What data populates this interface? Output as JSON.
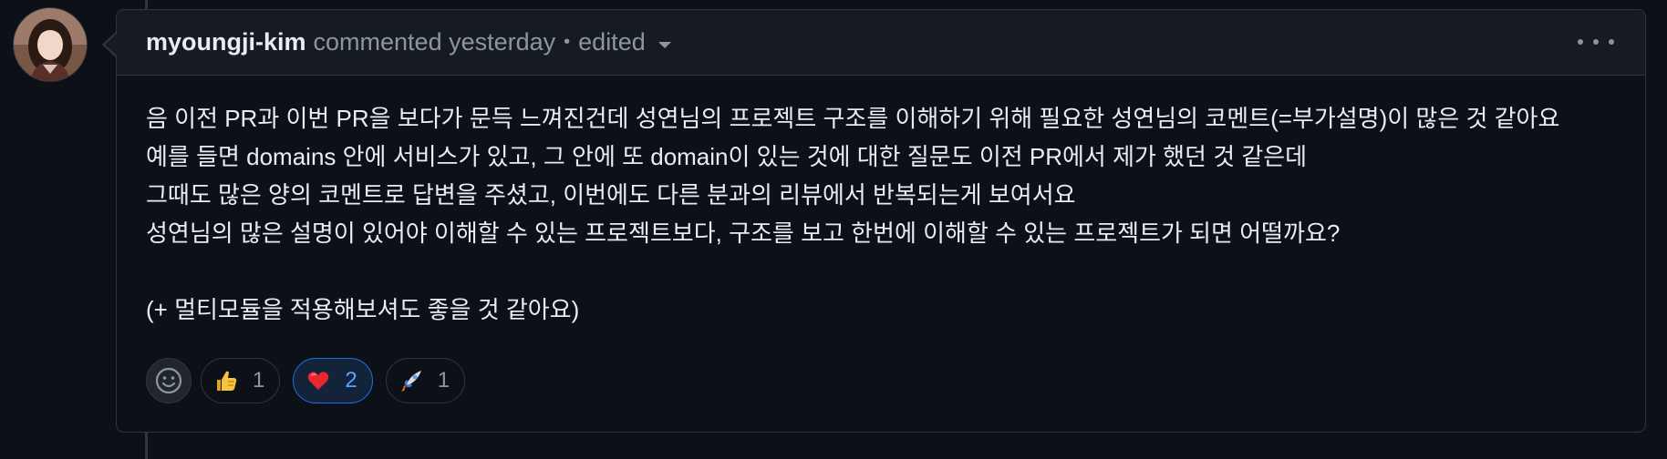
{
  "comment": {
    "author": "myoungji-kim",
    "action": "commented yesterday",
    "separator": "•",
    "edited_label": "edited",
    "body_lines": [
      "음 이전 PR과 이번 PR을 보다가 문득 느껴진건데 성연님의 프로젝트 구조를 이해하기 위해 필요한 성연님의 코멘트(=부가설명)이 많은 것 같아요",
      "예를 들면 domains 안에 서비스가 있고, 그 안에 또 domain이 있는 것에 대한 질문도 이전 PR에서 제가 했던 것 같은데",
      "그때도 많은 양의 코멘트로 답변을 주셨고, 이번에도 다른 분과의 리뷰에서 반복되는게 보여서요",
      "성연님의 많은 설명이 있어야 이해할 수 있는 프로젝트보다, 구조를 보고 한번에 이해할 수 있는 프로젝트가 되면 어떨까요?"
    ],
    "body_extra": "(+ 멀티모듈을 적용해보셔도 좋을 것 같아요)"
  },
  "reactions": [
    {
      "icon": "thumbs-up-icon",
      "count": "1",
      "active": false
    },
    {
      "icon": "heart-icon",
      "count": "2",
      "active": true
    },
    {
      "icon": "rocket-icon",
      "count": "1",
      "active": false
    }
  ],
  "colors": {
    "background": "#0d1117",
    "header_bg": "#161b22",
    "border": "#30363d",
    "muted_text": "#8d96a0",
    "accent": "#1f6feb",
    "accent_text": "#58a6ff"
  }
}
